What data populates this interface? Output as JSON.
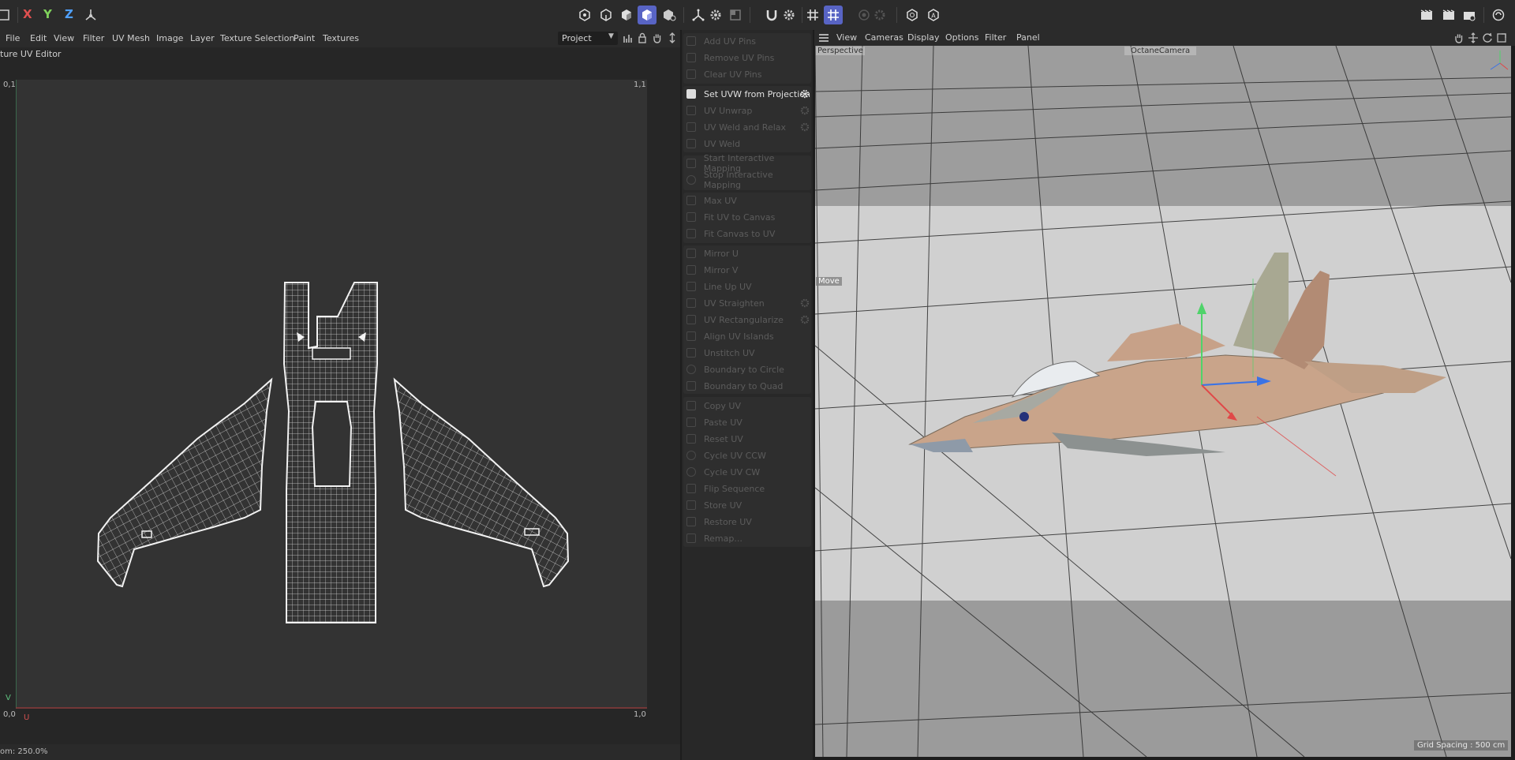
{
  "toolbar": {
    "axis_x": "X",
    "axis_y": "Y",
    "axis_z": "Z",
    "colors": {
      "x": "#e05050",
      "y": "#7fd15b",
      "z": "#4fa0ff",
      "accent": "#5864c4"
    }
  },
  "left_menu": {
    "items": [
      "File",
      "Edit",
      "View",
      "Filter",
      "UV Mesh",
      "Image",
      "Layer",
      "Texture Selection",
      "Paint",
      "Textures"
    ],
    "project_select": "Project"
  },
  "uv_editor": {
    "title": "ture UV Editor",
    "corner_tl": "0,1",
    "corner_tr": "1,1",
    "corner_bl": "0,0",
    "corner_br": "1,0",
    "axis_v": "V",
    "axis_u": "U",
    "zoom_status": "om: 250.0%"
  },
  "commands": [
    {
      "label": "Add UV Pins",
      "enabled": false,
      "gear": false
    },
    {
      "label": "Remove UV Pins",
      "enabled": false,
      "gear": false
    },
    {
      "label": "Clear UV Pins",
      "enabled": false,
      "gear": false
    },
    {
      "label": "Set UVW from Projection",
      "enabled": true,
      "gear": true
    },
    {
      "label": "UV Unwrap",
      "enabled": false,
      "gear": true
    },
    {
      "label": "UV Weld and Relax",
      "enabled": false,
      "gear": true
    },
    {
      "label": "UV Weld",
      "enabled": false,
      "gear": false
    },
    {
      "label": "Start Interactive Mapping",
      "enabled": false,
      "gear": false
    },
    {
      "label": "Stop Interactive Mapping",
      "enabled": false,
      "gear": false
    },
    {
      "label": "Max UV",
      "enabled": false,
      "gear": false
    },
    {
      "label": "Fit UV to Canvas",
      "enabled": false,
      "gear": false
    },
    {
      "label": "Fit Canvas to UV",
      "enabled": false,
      "gear": false
    },
    {
      "label": "Mirror U",
      "enabled": false,
      "gear": false
    },
    {
      "label": "Mirror V",
      "enabled": false,
      "gear": false
    },
    {
      "label": "Line Up UV",
      "enabled": false,
      "gear": false
    },
    {
      "label": "UV Straighten",
      "enabled": false,
      "gear": true
    },
    {
      "label": "UV Rectangularize",
      "enabled": false,
      "gear": true
    },
    {
      "label": "Align UV Islands",
      "enabled": false,
      "gear": false
    },
    {
      "label": "Unstitch UV",
      "enabled": false,
      "gear": false
    },
    {
      "label": "Boundary to Circle",
      "enabled": false,
      "gear": false
    },
    {
      "label": "Boundary to Quad",
      "enabled": false,
      "gear": false
    },
    {
      "label": "Copy UV",
      "enabled": false,
      "gear": false
    },
    {
      "label": "Paste UV",
      "enabled": false,
      "gear": false
    },
    {
      "label": "Reset UV",
      "enabled": false,
      "gear": false
    },
    {
      "label": "Cycle UV CCW",
      "enabled": false,
      "gear": false
    },
    {
      "label": "Cycle UV CW",
      "enabled": false,
      "gear": false
    },
    {
      "label": "Flip Sequence",
      "enabled": false,
      "gear": false
    },
    {
      "label": "Store UV",
      "enabled": false,
      "gear": false
    },
    {
      "label": "Restore UV",
      "enabled": false,
      "gear": false
    },
    {
      "label": "Remap...",
      "enabled": false,
      "gear": false
    }
  ],
  "viewport": {
    "menu": [
      "View",
      "Cameras",
      "Display",
      "Options",
      "Filter",
      "Panel"
    ],
    "perspective_label": "Perspective",
    "camera_label": "OctaneCamera",
    "tool_label": "Move",
    "grid_spacing": "Grid Spacing : 500 cm"
  }
}
